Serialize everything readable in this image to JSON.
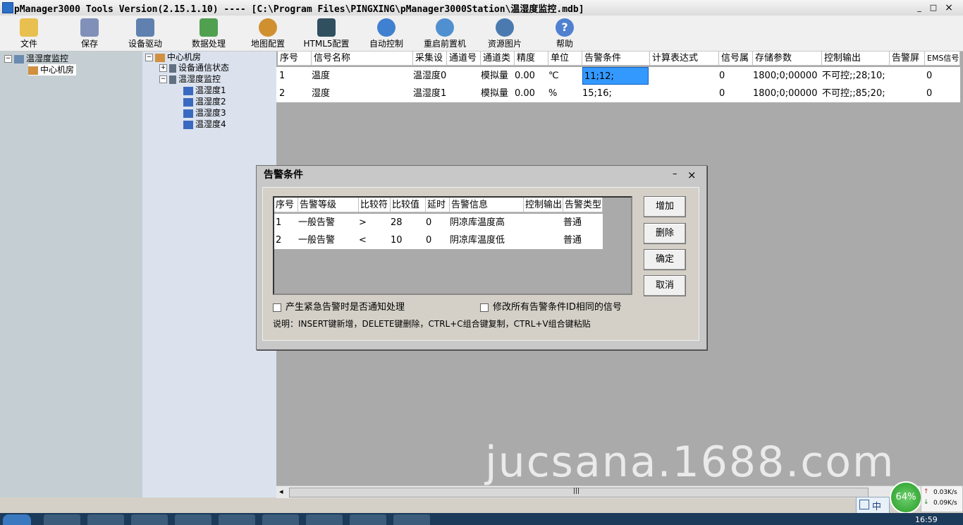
{
  "window": {
    "title": "pManager3000 Tools Version(2.15.1.10) ---- [C:\\Program Files\\PINGXING\\pManager3000Station\\温湿度监控.mdb]",
    "min": "_",
    "max": "□",
    "close": "×"
  },
  "toolbar": {
    "items": [
      {
        "label": "文件",
        "icon": "folder-icon",
        "color": "#e8c050"
      },
      {
        "label": "保存",
        "icon": "save-icon",
        "color": "#8090b8"
      },
      {
        "label": "设备驱动",
        "icon": "device-driver-icon",
        "color": "#6080b0"
      },
      {
        "label": "数据处理",
        "icon": "data-processing-icon",
        "color": "#50a050"
      },
      {
        "label": "地图配置",
        "icon": "gear-icon",
        "color": "#d09030"
      },
      {
        "label": "HTML5配置",
        "icon": "html5-icon",
        "color": "#305060"
      },
      {
        "label": "自动控制",
        "icon": "auto-control-icon",
        "color": "#4080d0"
      },
      {
        "label": "重启前置机",
        "icon": "restart-icon",
        "color": "#5090d0"
      },
      {
        "label": "资源图片",
        "icon": "resource-image-icon",
        "color": "#4a7ab0"
      },
      {
        "label": "帮助",
        "icon": "help-icon",
        "color": "#5080d0"
      }
    ]
  },
  "tree_left": {
    "root": "温湿度监控",
    "child": "中心机房"
  },
  "tree_right": {
    "root": "中心机房",
    "items": [
      "设备通信状态",
      "温湿度监控"
    ],
    "sub_items": [
      "温湿度1",
      "温湿度2",
      "温湿度3",
      "温湿度4"
    ]
  },
  "grid": {
    "headers": [
      "序号",
      "信号名称",
      "采集设",
      "通道号",
      "通道类",
      "精度",
      "单位",
      "告警条件",
      "计算表达式",
      "信号属",
      "存储参数",
      "控制输出",
      "告警屏",
      "EMS信号"
    ],
    "rows": [
      [
        "1",
        "温度",
        "温湿度0",
        "",
        "模拟量",
        "0.00",
        "℃",
        "11;12;",
        "",
        "0",
        "1800;0;00000",
        "不可控;;28;10;",
        "",
        "0"
      ],
      [
        "2",
        "湿度",
        "温湿度1",
        "",
        "模拟量",
        "0.00",
        "%",
        "15;16;",
        "",
        "0",
        "1800;0;00000",
        "不可控;;85;20;",
        "",
        "0"
      ]
    ],
    "selected_cell_color": "#3399ff"
  },
  "scrollbar": {
    "left_arrow": "◂",
    "right_arrow": "▸",
    "grip": "|||"
  },
  "dialog": {
    "title": "告警条件",
    "min": "–",
    "close": "×",
    "headers": [
      "序号",
      "告警等级",
      "比较符",
      "比较值",
      "延时",
      "告警信息",
      "控制输出",
      "告警类型"
    ],
    "rows": [
      [
        "1",
        "一般告警",
        ">",
        "28",
        "0",
        "阴凉库温度高",
        "",
        "普通"
      ],
      [
        "2",
        "一般告警",
        "<",
        "10",
        "0",
        "阴凉库温度低",
        "",
        "普通"
      ]
    ],
    "buttons": [
      "增加",
      "删除",
      "确定",
      "取消"
    ],
    "checkbox1": "产生紧急告警时是否通知处理",
    "checkbox2": "修改所有告警条件ID相同的信号",
    "note": "说明：INSERT键新增，DELETE键删除，CTRL+C组合键复制，CTRL+V组合键粘贴"
  },
  "watermark": "jucsana.1688.com",
  "tray": {
    "percent": "64%",
    "up_speed": "0.03K/s",
    "down_speed": "0.09K/s",
    "ime": "中",
    "time": "16:59"
  }
}
